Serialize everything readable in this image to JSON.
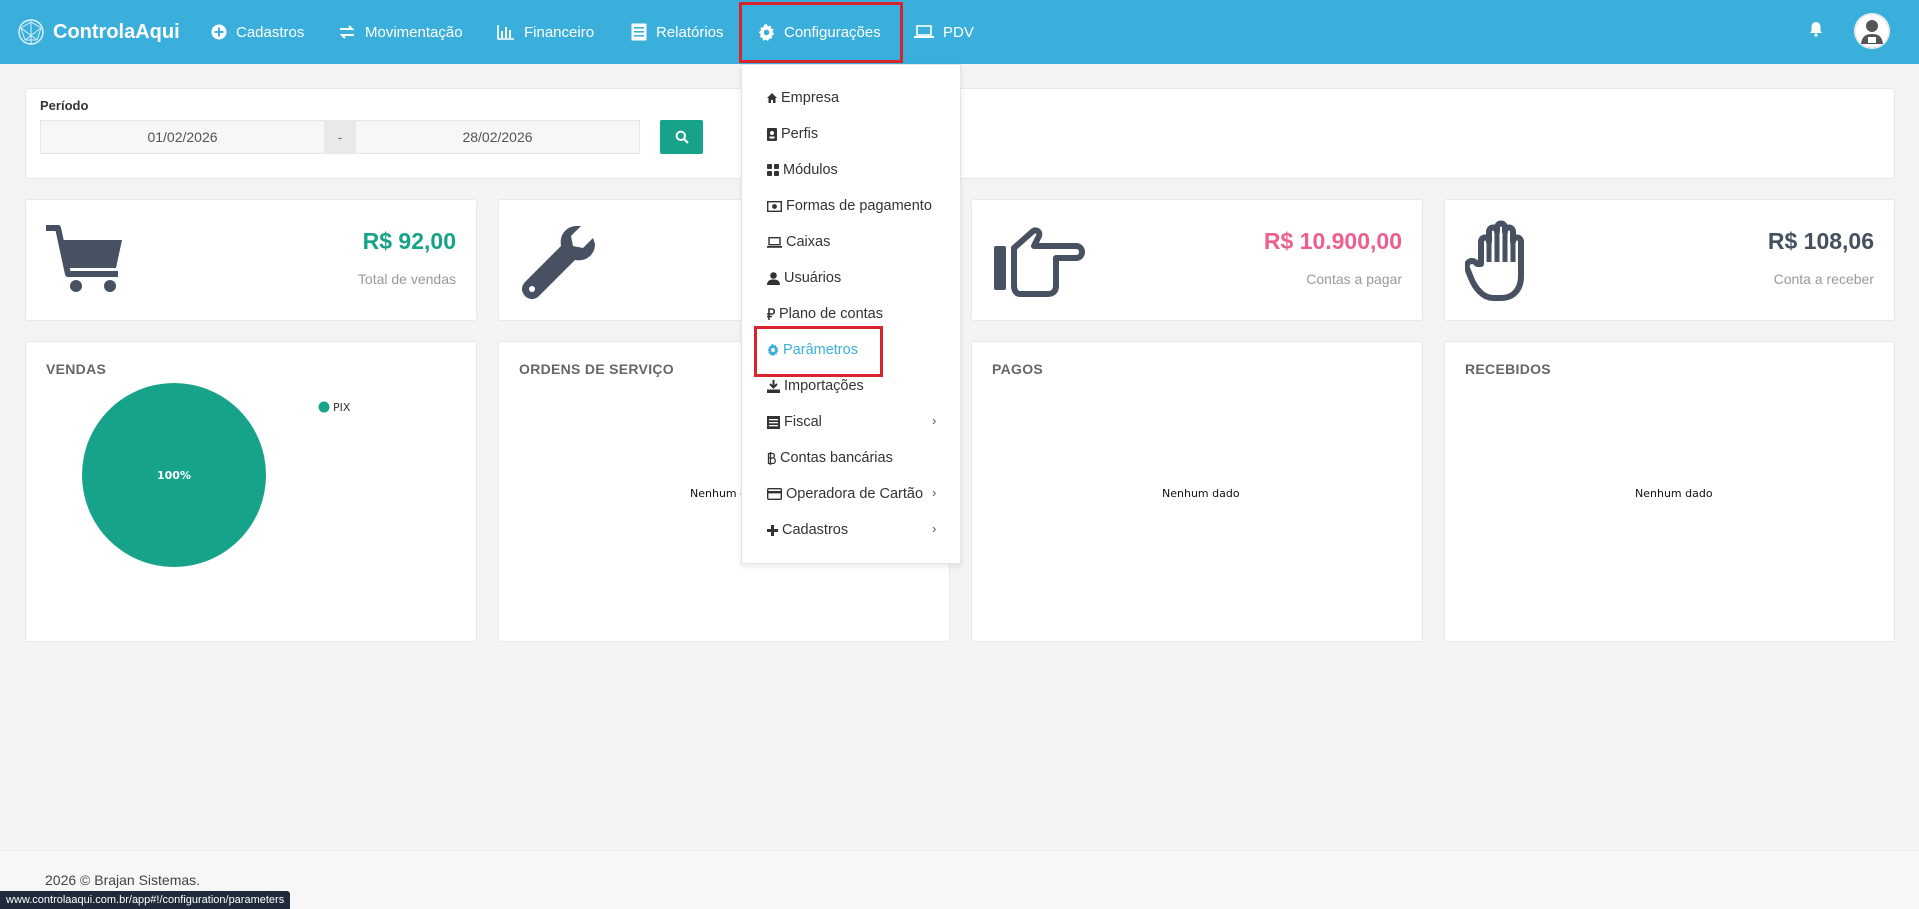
{
  "brand": {
    "name": "ControlaAqui",
    "icon": "globe-logo-icon"
  },
  "nav": {
    "items": [
      {
        "label": "Cadastros",
        "icon": "plus-circle-icon"
      },
      {
        "label": "Movimentação",
        "icon": "exchange-icon"
      },
      {
        "label": "Financeiro",
        "icon": "bar-chart-icon"
      },
      {
        "label": "Relatórios",
        "icon": "list-icon"
      },
      {
        "label": "Configurações",
        "icon": "gear-icon"
      },
      {
        "label": "PDV",
        "icon": "laptop-icon"
      }
    ]
  },
  "period": {
    "label": "Período",
    "start": "01/02/2026",
    "separator": "-",
    "end": "28/02/2026"
  },
  "stats": [
    {
      "value": "R$ 92,00",
      "label": "Total de vendas",
      "color": "#17a389",
      "icon": "cart-icon"
    },
    {
      "value": "",
      "label": "",
      "color": "#333333",
      "icon": "wrench-icon"
    },
    {
      "value": "R$ 10.900,00",
      "label": "Contas a pagar",
      "color": "#ec5f8f",
      "icon": "hand-pointing-right-icon"
    },
    {
      "value": "R$ 108,06",
      "label": "Conta a receber",
      "color": "#455060",
      "icon": "hand-open-icon"
    }
  ],
  "charts": {
    "vendas": {
      "title": "VENDAS",
      "legend": "PIX",
      "slice_label": "100%"
    },
    "ordens": {
      "title": "ORDENS DE SERVIÇO",
      "empty": "Nenhum d"
    },
    "pagos": {
      "title": "PAGOS",
      "empty": "Nenhum dado"
    },
    "recebidos": {
      "title": "RECEBIDOS",
      "empty": "Nenhum dado"
    }
  },
  "chart_data": {
    "type": "pie",
    "title": "VENDAS",
    "categories": [
      "PIX"
    ],
    "values": [
      100
    ],
    "colors": [
      "#17a389"
    ]
  },
  "dropdown": {
    "items": [
      {
        "label": "Empresa",
        "icon": "home-icon"
      },
      {
        "label": "Perfis",
        "icon": "id-badge-icon"
      },
      {
        "label": "Módulos",
        "icon": "grid-icon"
      },
      {
        "label": "Formas de pagamento",
        "icon": "money-icon"
      },
      {
        "label": "Caixas",
        "icon": "laptop-icon"
      },
      {
        "label": "Usuários",
        "icon": "user-icon"
      },
      {
        "label": "Plano de contas",
        "icon": "ruble-icon"
      },
      {
        "label": "Parâmetros",
        "icon": "gear-icon"
      },
      {
        "label": "Importações",
        "icon": "download-icon"
      },
      {
        "label": "Fiscal",
        "icon": "list-icon"
      },
      {
        "label": "Contas bancárias",
        "icon": "bitcoin-icon"
      },
      {
        "label": "Operadora de Cartão",
        "icon": "credit-card-icon"
      },
      {
        "label": "Cadastros",
        "icon": "plus-icon"
      }
    ],
    "chevron": "›"
  },
  "footer": {
    "text": "2026 © Brajan Sistemas."
  },
  "statusbar": {
    "url": "www.controlaaqui.com.br/app#!/configuration/parameters"
  },
  "colors": {
    "topbar": "#3aafdb",
    "accent": "#17a389",
    "highlight": "#d9232d"
  }
}
